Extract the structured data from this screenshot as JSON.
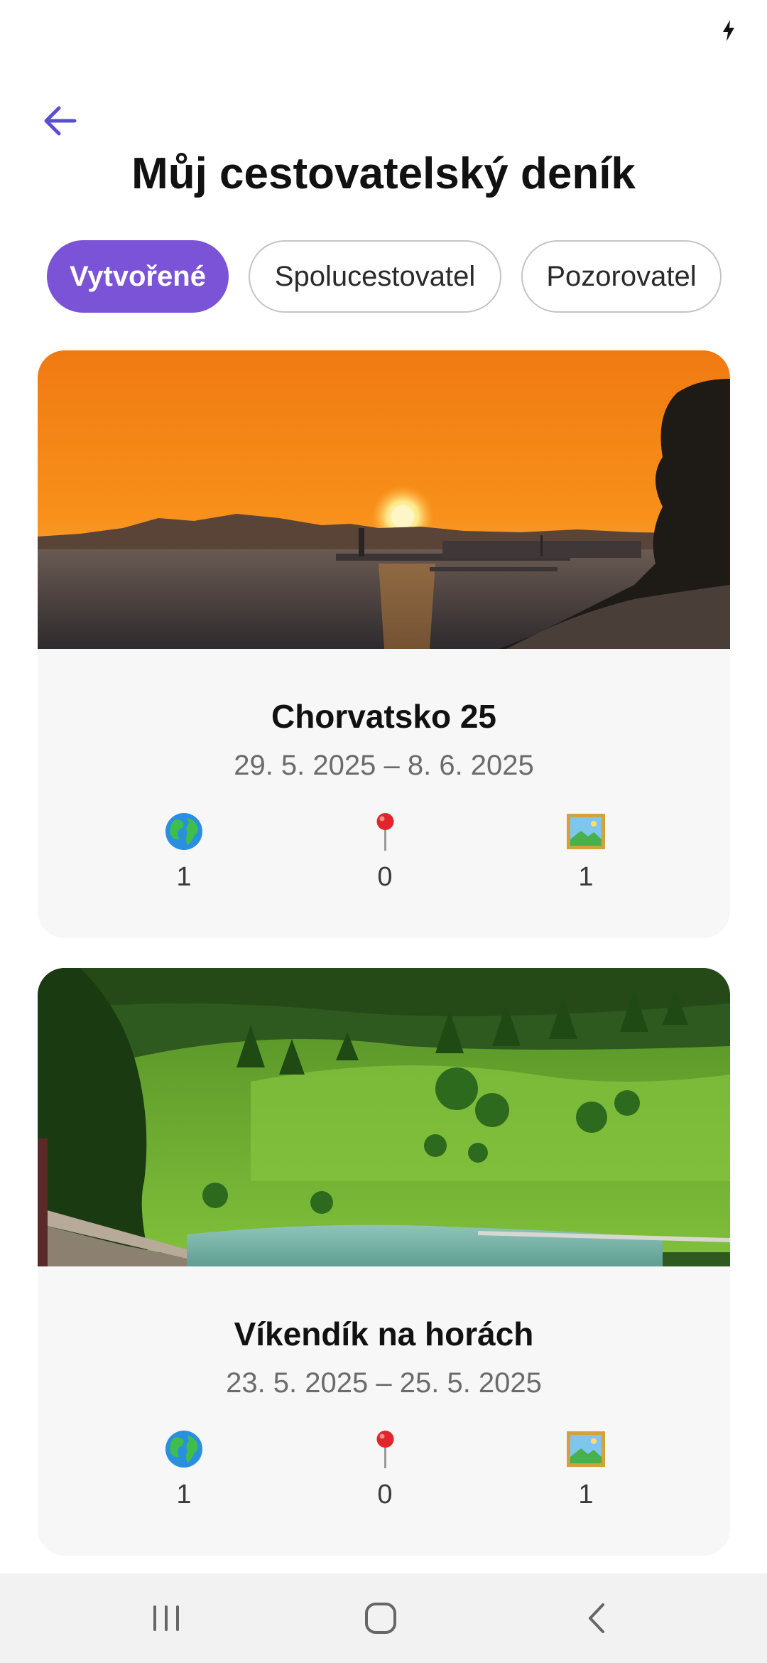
{
  "header": {
    "title": "Můj cestovatelský deník",
    "back_icon": "arrow-left-icon"
  },
  "tabs": [
    {
      "label": "Vytvořené",
      "active": true
    },
    {
      "label": "Spolucestovatel",
      "active": false
    },
    {
      "label": "Pozorovatel",
      "active": false
    }
  ],
  "trips": [
    {
      "title": "Chorvatsko 25",
      "dates": "29. 5. 2025 – 8. 6. 2025",
      "image": "sunset-sea-photo",
      "stats": [
        {
          "icon": "globe-icon",
          "value": "1"
        },
        {
          "icon": "pin-icon",
          "value": "0"
        },
        {
          "icon": "picture-icon",
          "value": "1"
        }
      ]
    },
    {
      "title": "Víkendík na horách",
      "dates": "23. 5. 2025 – 25. 5. 2025",
      "image": "mountain-meadow-photo",
      "stats": [
        {
          "icon": "globe-icon",
          "value": "1"
        },
        {
          "icon": "pin-icon",
          "value": "0"
        },
        {
          "icon": "picture-icon",
          "value": "1"
        }
      ]
    }
  ],
  "colors": {
    "accent": "#7b53d6",
    "back_arrow": "#5b4fd1",
    "card_bg": "#f7f7f7",
    "nav_bar_bg": "#f2f2f2"
  }
}
